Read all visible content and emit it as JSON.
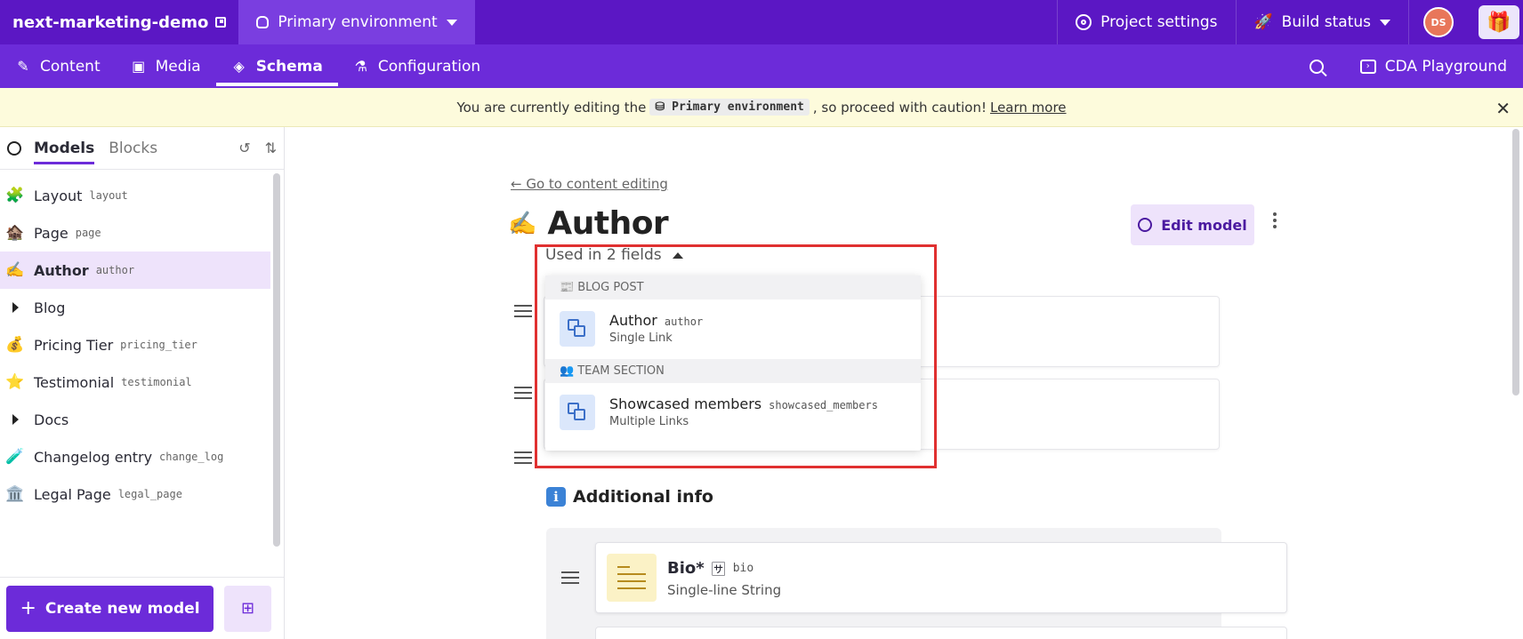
{
  "topbar": {
    "project_name": "next-marketing-demo",
    "environment": "Primary environment",
    "project_settings": "Project settings",
    "build_status": "Build status",
    "avatar_initials": "DS"
  },
  "nav": {
    "items": [
      {
        "label": "Content",
        "icon": "edit-icon"
      },
      {
        "label": "Media",
        "icon": "image-icon"
      },
      {
        "label": "Schema",
        "icon": "layers-icon"
      },
      {
        "label": "Configuration",
        "icon": "flask-icon"
      }
    ],
    "active": "Schema",
    "cda_playground": "CDA Playground"
  },
  "banner": {
    "text_before": "You are currently editing the",
    "env_code": "Primary environment",
    "text_after": ", so proceed with caution!",
    "link": "Learn more"
  },
  "sidebar": {
    "tabs": [
      "Models",
      "Blocks"
    ],
    "items": [
      {
        "emoji": "🧩",
        "name": "Layout",
        "api": "layout"
      },
      {
        "emoji": "🏚️",
        "name": "Page",
        "api": "page"
      },
      {
        "emoji": "✍️",
        "name": "Author",
        "api": "author"
      },
      {
        "name": "Blog",
        "api": ""
      },
      {
        "emoji": "💰",
        "name": "Pricing Tier",
        "api": "pricing_tier"
      },
      {
        "emoji": "⭐",
        "name": "Testimonial",
        "api": "testimonial"
      },
      {
        "name": "Docs",
        "api": ""
      },
      {
        "emoji": "🧪",
        "name": "Changelog entry",
        "api": "change_log"
      },
      {
        "emoji": "🏛️",
        "name": "Legal Page",
        "api": "legal_page"
      }
    ],
    "create_label": "Create new model"
  },
  "main": {
    "back_link": "← Go to content editing",
    "title_emoji": "✍️",
    "title": "Author",
    "edit_model": "Edit model",
    "used_in": "Used in 2 fields",
    "section_emoji": "i",
    "section_title": "Additional info",
    "bio": {
      "name": "Bio*",
      "api": "bio",
      "type": "Single-line String"
    }
  },
  "dropdown": {
    "groups": [
      {
        "emoji": "📰",
        "label": "BLOG POST",
        "field": "Author",
        "api": "author",
        "type": "Single Link"
      },
      {
        "emoji": "👥",
        "label": "TEAM SECTION",
        "field": "Showcased members",
        "api": "showcased_members",
        "type": "Multiple Links"
      }
    ]
  }
}
